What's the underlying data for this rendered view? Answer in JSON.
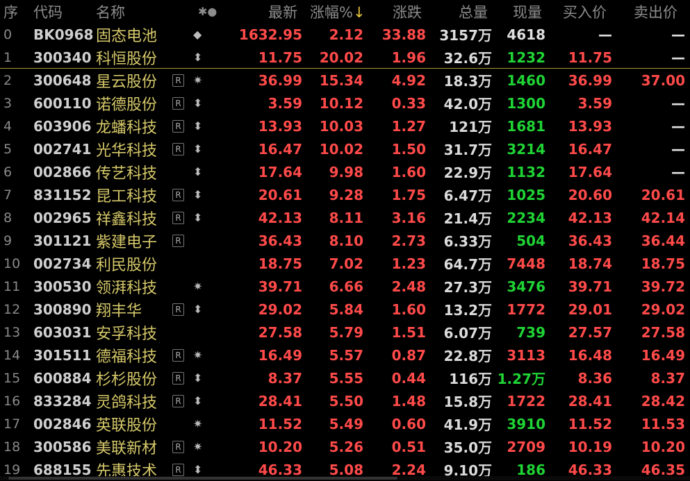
{
  "header": {
    "seq": "序",
    "code": "代码",
    "name": "名称",
    "mark": "✱●",
    "latest": "最新",
    "pct": "涨幅%",
    "pct_arrow": "↓",
    "chg": "涨跌",
    "vol": "总量",
    "cur": "现量",
    "bid": "买入价",
    "ask": "卖出价"
  },
  "colors": {
    "up": "#ff4a4a",
    "down_vol": "#1fd435",
    "name": "#d6c96a",
    "separator": "#a89a36"
  },
  "rows": [
    {
      "seq": "0",
      "code": "BK0968",
      "name": "固态电池",
      "r": "",
      "mark": "◆",
      "latest": "1632.95",
      "pct": "2.12",
      "chg": "33.88",
      "vol": "3157万",
      "cur": "4618",
      "cur_color": "white",
      "bid": "—",
      "ask": "—"
    },
    {
      "seq": "1",
      "code": "300340",
      "name": "科恒股份",
      "r": "",
      "mark": "⬍",
      "latest": "11.75",
      "pct": "20.02",
      "chg": "1.96",
      "vol": "32.6万",
      "cur": "1232",
      "cur_color": "green",
      "bid": "11.75",
      "ask": "—"
    },
    {
      "seq": "2",
      "code": "300648",
      "name": "星云股份",
      "r": "R",
      "mark": "✷",
      "latest": "36.99",
      "pct": "15.34",
      "chg": "4.92",
      "vol": "18.3万",
      "cur": "1460",
      "cur_color": "green",
      "bid": "36.99",
      "ask": "37.00"
    },
    {
      "seq": "3",
      "code": "600110",
      "name": "诺德股份",
      "r": "R",
      "mark": "⬍",
      "latest": "3.59",
      "pct": "10.12",
      "chg": "0.33",
      "vol": "42.0万",
      "cur": "1300",
      "cur_color": "green",
      "bid": "3.59",
      "ask": "—"
    },
    {
      "seq": "4",
      "code": "603906",
      "name": "龙蟠科技",
      "r": "R",
      "mark": "⬍",
      "latest": "13.93",
      "pct": "10.03",
      "chg": "1.27",
      "vol": "121万",
      "cur": "1681",
      "cur_color": "green",
      "bid": "13.93",
      "ask": "—"
    },
    {
      "seq": "5",
      "code": "002741",
      "name": "光华科技",
      "r": "R",
      "mark": "⬍",
      "latest": "16.47",
      "pct": "10.02",
      "chg": "1.50",
      "vol": "31.7万",
      "cur": "3214",
      "cur_color": "green",
      "bid": "16.47",
      "ask": "—"
    },
    {
      "seq": "6",
      "code": "002866",
      "name": "传艺科技",
      "r": "",
      "mark": "⬍",
      "latest": "17.64",
      "pct": "9.98",
      "chg": "1.60",
      "vol": "22.9万",
      "cur": "1132",
      "cur_color": "green",
      "bid": "17.64",
      "ask": "—"
    },
    {
      "seq": "7",
      "code": "831152",
      "name": "昆工科技",
      "r": "R",
      "mark": "⬍",
      "latest": "20.61",
      "pct": "9.28",
      "chg": "1.75",
      "vol": "6.47万",
      "cur": "1025",
      "cur_color": "green",
      "bid": "20.60",
      "ask": "20.61"
    },
    {
      "seq": "8",
      "code": "002965",
      "name": "祥鑫科技",
      "r": "R",
      "mark": "⬍",
      "latest": "42.13",
      "pct": "8.11",
      "chg": "3.16",
      "vol": "21.4万",
      "cur": "2234",
      "cur_color": "green",
      "bid": "42.13",
      "ask": "42.14"
    },
    {
      "seq": "9",
      "code": "301121",
      "name": "紫建电子",
      "r": "R",
      "mark": "",
      "latest": "36.43",
      "pct": "8.10",
      "chg": "2.73",
      "vol": "6.33万",
      "cur": "504",
      "cur_color": "green",
      "bid": "36.43",
      "ask": "36.44"
    },
    {
      "seq": "10",
      "code": "002734",
      "name": "利民股份",
      "r": "",
      "mark": "",
      "latest": "18.75",
      "pct": "7.02",
      "chg": "1.23",
      "vol": "64.7万",
      "cur": "7448",
      "cur_color": "red",
      "bid": "18.74",
      "ask": "18.75"
    },
    {
      "seq": "11",
      "code": "300530",
      "name": "领湃科技",
      "r": "",
      "mark": "✷",
      "latest": "39.71",
      "pct": "6.66",
      "chg": "2.48",
      "vol": "27.3万",
      "cur": "3476",
      "cur_color": "green",
      "bid": "39.71",
      "ask": "39.72"
    },
    {
      "seq": "12",
      "code": "300890",
      "name": "翔丰华",
      "r": "R",
      "mark": "⬍",
      "latest": "29.02",
      "pct": "5.84",
      "chg": "1.60",
      "vol": "13.2万",
      "cur": "1772",
      "cur_color": "red",
      "bid": "29.01",
      "ask": "29.02"
    },
    {
      "seq": "13",
      "code": "603031",
      "name": "安孚科技",
      "r": "",
      "mark": "",
      "latest": "27.58",
      "pct": "5.79",
      "chg": "1.51",
      "vol": "6.07万",
      "cur": "739",
      "cur_color": "green",
      "bid": "27.57",
      "ask": "27.58"
    },
    {
      "seq": "14",
      "code": "301511",
      "name": "德福科技",
      "r": "R",
      "mark": "✷",
      "latest": "16.49",
      "pct": "5.57",
      "chg": "0.87",
      "vol": "22.8万",
      "cur": "3113",
      "cur_color": "red",
      "bid": "16.48",
      "ask": "16.49"
    },
    {
      "seq": "15",
      "code": "600884",
      "name": "杉杉股份",
      "r": "R",
      "mark": "⬍",
      "latest": "8.37",
      "pct": "5.55",
      "chg": "0.44",
      "vol": "116万",
      "cur": "1.27万",
      "cur_color": "green",
      "bid": "8.36",
      "ask": "8.37"
    },
    {
      "seq": "16",
      "code": "833284",
      "name": "灵鸽科技",
      "r": "R",
      "mark": "⬍",
      "latest": "28.41",
      "pct": "5.50",
      "chg": "1.48",
      "vol": "15.8万",
      "cur": "1722",
      "cur_color": "red",
      "bid": "28.41",
      "ask": "28.42"
    },
    {
      "seq": "17",
      "code": "002846",
      "name": "英联股份",
      "r": "",
      "mark": "✷",
      "latest": "11.52",
      "pct": "5.49",
      "chg": "0.60",
      "vol": "41.9万",
      "cur": "3910",
      "cur_color": "green",
      "bid": "11.52",
      "ask": "11.53"
    },
    {
      "seq": "18",
      "code": "300586",
      "name": "美联新材",
      "r": "R",
      "mark": "✷",
      "latest": "10.20",
      "pct": "5.26",
      "chg": "0.51",
      "vol": "35.0万",
      "cur": "2709",
      "cur_color": "red",
      "bid": "10.19",
      "ask": "10.20"
    },
    {
      "seq": "19",
      "code": "688155",
      "name": "先惠技术",
      "r": "R",
      "mark": "⬍",
      "latest": "46.33",
      "pct": "5.08",
      "chg": "2.24",
      "vol": "9.10万",
      "cur": "186",
      "cur_color": "green",
      "bid": "46.33",
      "ask": "46.35"
    }
  ]
}
